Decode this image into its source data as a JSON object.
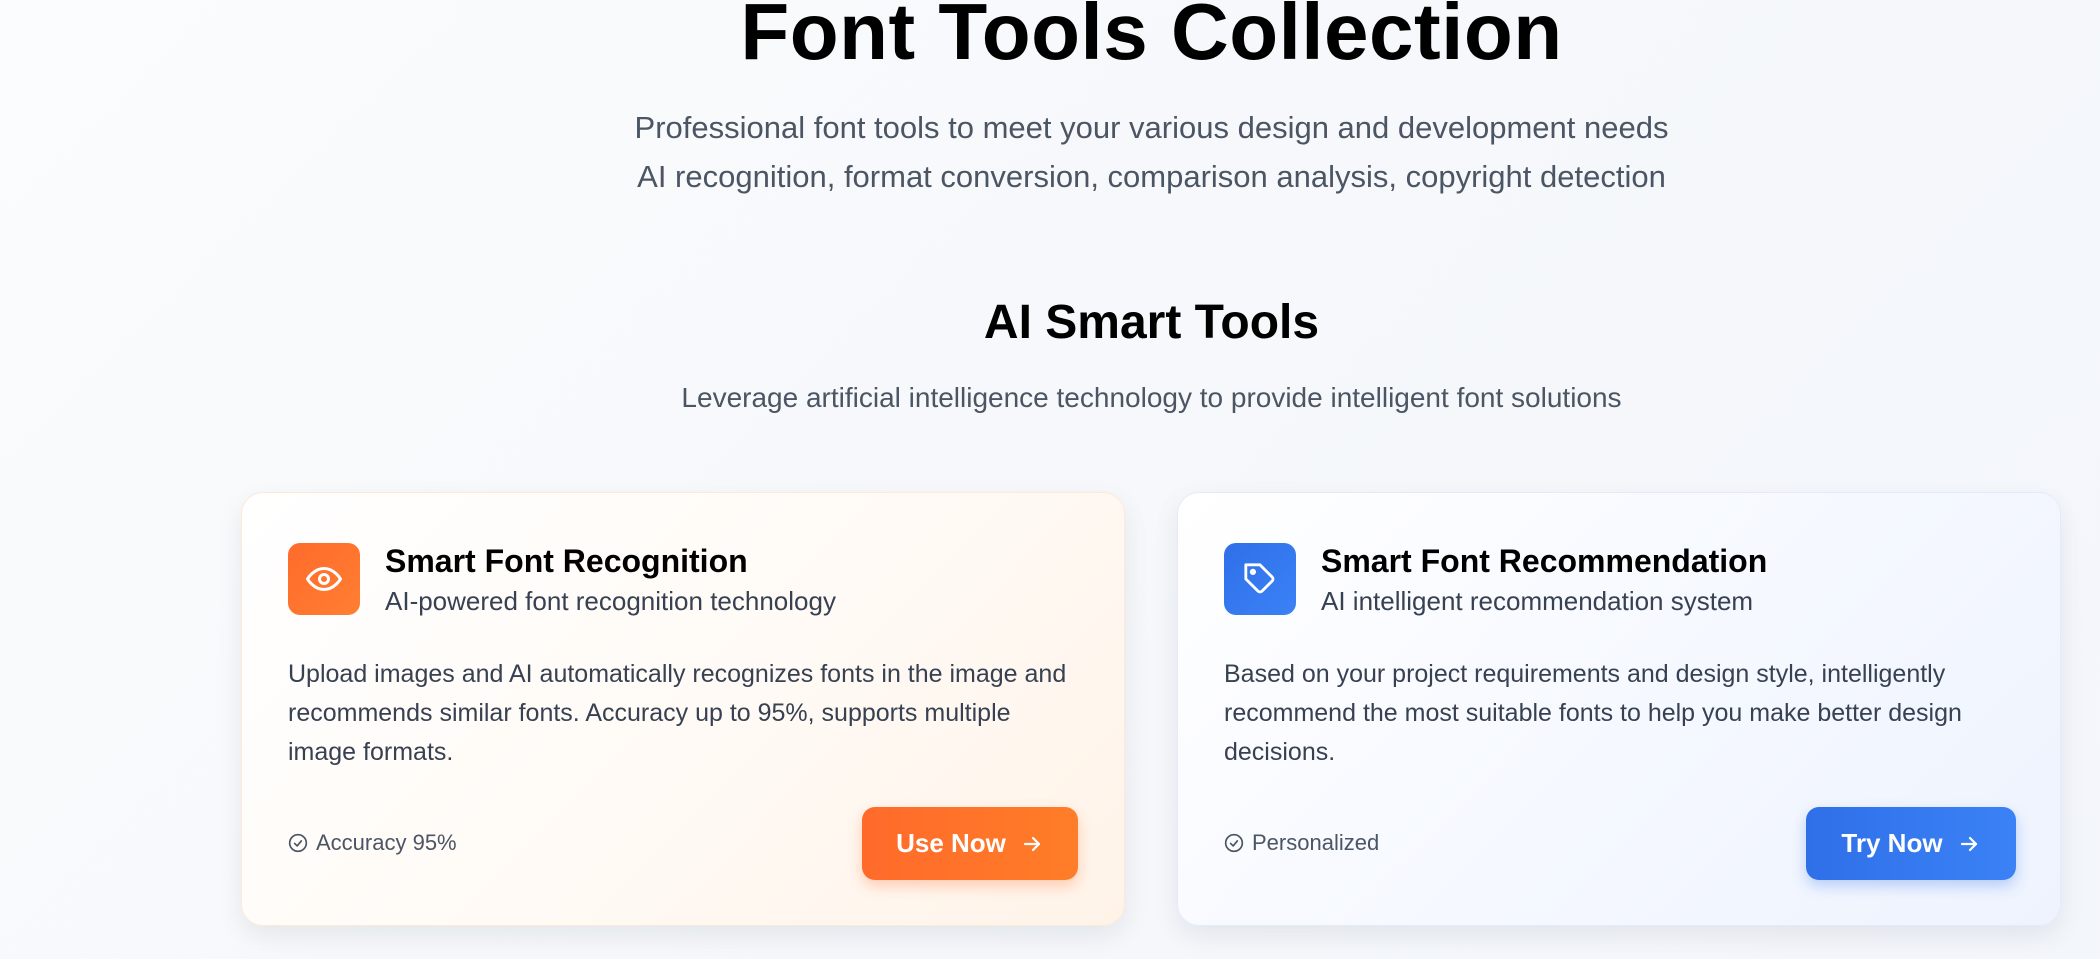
{
  "hero": {
    "title": "Font Tools Collection",
    "subtitle_line1": "Professional font tools to meet your various design and development needs",
    "subtitle_line2": "AI recognition, format conversion, comparison analysis, copyright detection"
  },
  "section": {
    "title": "AI Smart Tools",
    "subtitle": "Leverage artificial intelligence technology to provide intelligent font solutions"
  },
  "cards": [
    {
      "icon": "eye-icon",
      "title": "Smart Font Recognition",
      "subtitle": "AI-powered font recognition technology",
      "description": "Upload images and AI automatically recognizes fonts in the image and recommends similar fonts. Accuracy up to 95%, supports multiple image formats.",
      "badge": "Accuracy 95%",
      "button_label": "Use Now",
      "accent": "#ff6a2b"
    },
    {
      "icon": "tag-icon",
      "title": "Smart Font Recommendation",
      "subtitle": "AI intelligent recommendation system",
      "description": "Based on your project requirements and design style, intelligently recommend the most suitable fonts to help you make better design decisions.",
      "badge": "Personalized",
      "button_label": "Try Now",
      "accent": "#2f6fe8"
    }
  ]
}
